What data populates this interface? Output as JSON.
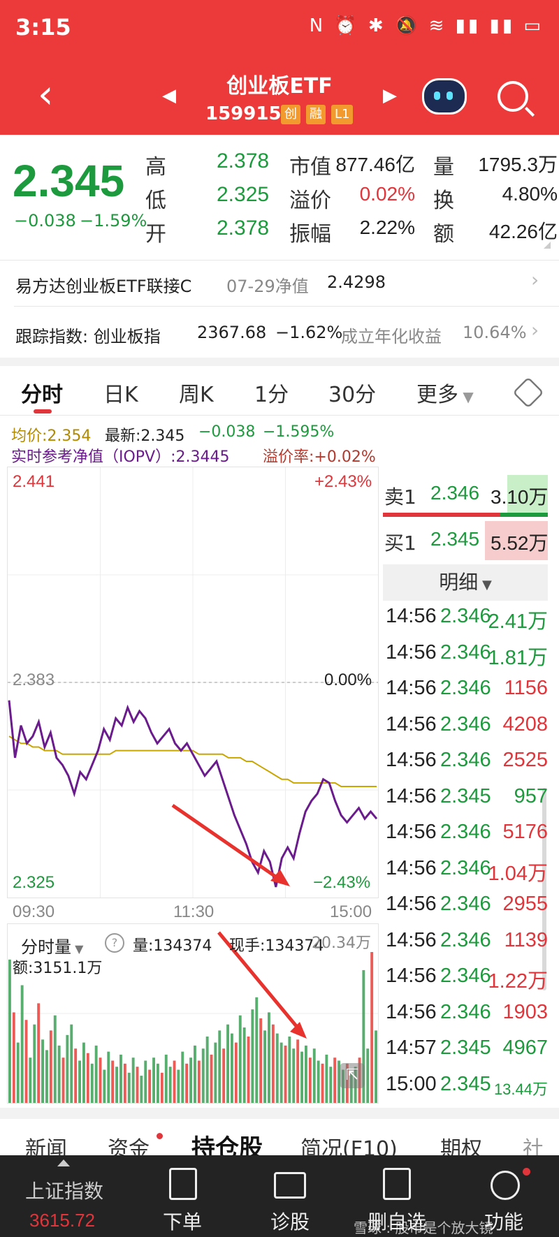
{
  "status": {
    "time": "3:15",
    "icons": "N ⏰ ✱ 🔕 ≋ ▮▮ ▮▮ ▭"
  },
  "header": {
    "title": "创业板ETF",
    "code": "159915",
    "tags": [
      "创",
      "融",
      "L1"
    ]
  },
  "quote": {
    "price": "2.345",
    "change": "−0.038",
    "change_pct": "−1.59%",
    "high_label": "高",
    "high": "2.378",
    "low_label": "低",
    "low": "2.325",
    "open_label": "开",
    "open": "2.378",
    "mktcap_label": "市值",
    "mktcap": "877.46亿",
    "premium_label": "溢价",
    "premium": "0.02%",
    "amplitude_label": "振幅",
    "amplitude": "2.22%",
    "volume_label": "量",
    "volume": "1795.3万",
    "turnover_label": "换",
    "turnover": "4.80%",
    "amount_label": "额",
    "amount": "42.26亿"
  },
  "link_fund": {
    "name": "易方达创业板ETF联接C",
    "date": "07-29净值",
    "nav": "2.4298"
  },
  "tracking": {
    "label": "跟踪指数: 创业板指",
    "value": "2367.68",
    "pct": "−1.62%",
    "annual_label": "成立年化收益",
    "annual": "10.64%"
  },
  "tabs": [
    "分时",
    "日K",
    "周K",
    "1分",
    "30分",
    "更多"
  ],
  "intraday_info": {
    "avg": "均价:2.354",
    "latest": "最新:2.345",
    "chg": "−0.038",
    "pct": "−1.595%",
    "iopv": "实时参考净值（IOPV）:2.3445",
    "premium": "溢价率:+0.02%"
  },
  "chart_data": {
    "type": "line",
    "x_ticks": [
      "09:30",
      "11:30",
      "15:00"
    ],
    "y_left": [
      "2.441",
      "2.383",
      "2.325"
    ],
    "y_right": [
      "+2.43%",
      "0.00%",
      "−2.43%"
    ],
    "ylim": [
      2.325,
      2.441
    ],
    "series": [
      {
        "name": "价格",
        "color": "#6a1b8c",
        "values": [
          2.378,
          2.362,
          2.371,
          2.366,
          2.368,
          2.372,
          2.365,
          2.369,
          2.362,
          2.36,
          2.357,
          2.352,
          2.358,
          2.356,
          2.36,
          2.364,
          2.37,
          2.367,
          2.373,
          2.371,
          2.376,
          2.372,
          2.375,
          2.373,
          2.369,
          2.366,
          2.368,
          2.37,
          2.366,
          2.364,
          2.366,
          2.363,
          2.36,
          2.357,
          2.359,
          2.361,
          2.356,
          2.351,
          2.346,
          2.342,
          2.338,
          2.333,
          2.33,
          2.336,
          2.333,
          2.326,
          2.334,
          2.337,
          2.334,
          2.341,
          2.347,
          2.35,
          2.352,
          2.356,
          2.355,
          2.35,
          2.346,
          2.344,
          2.346,
          2.348,
          2.345,
          2.347,
          2.345
        ]
      },
      {
        "name": "均价",
        "color": "#c9a600",
        "values": [
          2.368,
          2.367,
          2.366,
          2.366,
          2.365,
          2.365,
          2.364,
          2.364,
          2.364,
          2.363,
          2.363,
          2.363,
          2.363,
          2.363,
          2.363,
          2.363,
          2.363,
          2.363,
          2.364,
          2.364,
          2.364,
          2.364,
          2.364,
          2.364,
          2.364,
          2.364,
          2.364,
          2.364,
          2.364,
          2.364,
          2.364,
          2.364,
          2.363,
          2.363,
          2.363,
          2.363,
          2.363,
          2.362,
          2.362,
          2.362,
          2.361,
          2.361,
          2.36,
          2.359,
          2.358,
          2.357,
          2.356,
          2.356,
          2.355,
          2.355,
          2.355,
          2.355,
          2.355,
          2.355,
          2.355,
          2.355,
          2.354,
          2.354,
          2.354,
          2.354,
          2.354,
          2.354,
          2.354
        ]
      }
    ],
    "volume": {
      "label": "分时量",
      "qty": "量:134374",
      "current": "现手:134374",
      "max": "20.34万",
      "amount": "额:3151.1万",
      "values": [
        95,
        60,
        40,
        78,
        55,
        30,
        52,
        66,
        42,
        35,
        48,
        58,
        38,
        30,
        45,
        52,
        36,
        28,
        40,
        33,
        26,
        38,
        30,
        22,
        34,
        28,
        24,
        32,
        26,
        20,
        30,
        24,
        18,
        28,
        22,
        30,
        26,
        20,
        32,
        24,
        28,
        22,
        34,
        26,
        30,
        38,
        28,
        36,
        44,
        32,
        40,
        48,
        36,
        52,
        46,
        40,
        58,
        50,
        44,
        62,
        70,
        56,
        48,
        60,
        52,
        46,
        40,
        38,
        44,
        36,
        42,
        34,
        38,
        30,
        36,
        28,
        26,
        32,
        24,
        30,
        28,
        22,
        26,
        20,
        24,
        30,
        88,
        36,
        100,
        48
      ]
    }
  },
  "order_book": {
    "sell": {
      "label": "卖1",
      "price": "2.346",
      "vol": "3.10万"
    },
    "buy": {
      "label": "买1",
      "price": "2.345",
      "vol": "5.52万"
    },
    "detail_label": "明细"
  },
  "ticks": [
    {
      "t": "14:56",
      "p": "2.346",
      "v": "2.41万",
      "c": "green"
    },
    {
      "t": "14:56",
      "p": "2.346",
      "v": "1.81万",
      "c": "green"
    },
    {
      "t": "14:56",
      "p": "2.346",
      "v": "1156",
      "c": "red"
    },
    {
      "t": "14:56",
      "p": "2.346",
      "v": "4208",
      "c": "red"
    },
    {
      "t": "14:56",
      "p": "2.346",
      "v": "2525",
      "c": "red"
    },
    {
      "t": "14:56",
      "p": "2.345",
      "v": "957",
      "c": "green"
    },
    {
      "t": "14:56",
      "p": "2.346",
      "v": "5176",
      "c": "red"
    },
    {
      "t": "14:56",
      "p": "2.346",
      "v": "1.04万",
      "c": "red"
    },
    {
      "t": "14:56",
      "p": "2.346",
      "v": "2955",
      "c": "red"
    },
    {
      "t": "14:56",
      "p": "2.346",
      "v": "1139",
      "c": "red"
    },
    {
      "t": "14:56",
      "p": "2.346",
      "v": "1.22万",
      "c": "red"
    },
    {
      "t": "14:56",
      "p": "2.346",
      "v": "1903",
      "c": "red"
    },
    {
      "t": "14:57",
      "p": "2.345",
      "v": "4967",
      "c": "green"
    },
    {
      "t": "15:00",
      "p": "2.345",
      "v": "13.44万",
      "c": "green"
    }
  ],
  "bottom_tabs": [
    "新闻",
    "资金",
    "持仓股",
    "简况(F10)",
    "期权",
    "社"
  ],
  "footer": {
    "index_name": "上证指数",
    "index_value": "3615.72",
    "items": [
      "下单",
      "诊股",
      "删自选",
      "功能"
    ],
    "watermark": "雪球 : 股市是个放大镜"
  }
}
